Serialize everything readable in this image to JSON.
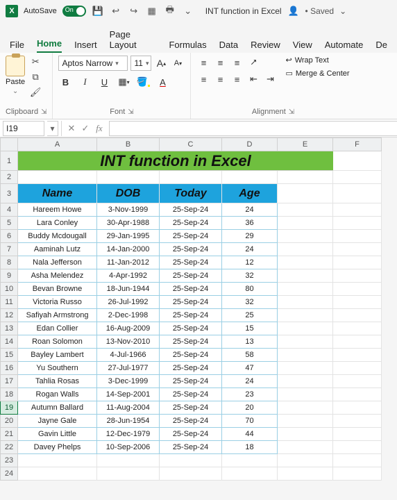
{
  "titlebar": {
    "autosave_label": "AutoSave",
    "autosave_on_text": "On",
    "doc_title": "INT function in Excel",
    "saved_status": "• Saved",
    "saved_caret": "⌄"
  },
  "ribbon_tabs": [
    "File",
    "Home",
    "Insert",
    "Page Layout",
    "Formulas",
    "Data",
    "Review",
    "View",
    "Automate",
    "De"
  ],
  "active_ribbon_tab": "Home",
  "clipboard": {
    "paste_label": "Paste",
    "group_label": "Clipboard"
  },
  "font": {
    "name": "Aptos Narrow",
    "size": "11",
    "group_label": "Font",
    "increase_label": "A",
    "decrease_label": "A",
    "bold": "B",
    "italic": "I",
    "underline": "U"
  },
  "alignment": {
    "group_label": "Alignment",
    "wrap_label": "Wrap Text",
    "merge_label": "Merge & Center"
  },
  "name_box": "I19",
  "formula_value": "",
  "columns": [
    "A",
    "B",
    "C",
    "D",
    "E",
    "F"
  ],
  "row_numbers": [
    "1",
    "2",
    "3",
    "4",
    "5",
    "6",
    "7",
    "8",
    "9",
    "10",
    "11",
    "12",
    "13",
    "14",
    "15",
    "16",
    "17",
    "18",
    "19",
    "20",
    "21",
    "22",
    "23",
    "24"
  ],
  "selected_row": "19",
  "sheet": {
    "title": "INT function in Excel",
    "headers": {
      "name": "Name",
      "dob": "DOB",
      "today": "Today",
      "age": "Age"
    },
    "rows": [
      {
        "name": "Hareem Howe",
        "dob": "3-Nov-1999",
        "today": "25-Sep-24",
        "age": "24"
      },
      {
        "name": "Lara Conley",
        "dob": "30-Apr-1988",
        "today": "25-Sep-24",
        "age": "36"
      },
      {
        "name": "Buddy Mcdougall",
        "dob": "29-Jan-1995",
        "today": "25-Sep-24",
        "age": "29"
      },
      {
        "name": "Aaminah Lutz",
        "dob": "14-Jan-2000",
        "today": "25-Sep-24",
        "age": "24"
      },
      {
        "name": "Nala Jefferson",
        "dob": "11-Jan-2012",
        "today": "25-Sep-24",
        "age": "12"
      },
      {
        "name": "Asha Melendez",
        "dob": "4-Apr-1992",
        "today": "25-Sep-24",
        "age": "32"
      },
      {
        "name": "Bevan Browne",
        "dob": "18-Jun-1944",
        "today": "25-Sep-24",
        "age": "80"
      },
      {
        "name": "Victoria Russo",
        "dob": "26-Jul-1992",
        "today": "25-Sep-24",
        "age": "32"
      },
      {
        "name": "Safiyah Armstrong",
        "dob": "2-Dec-1998",
        "today": "25-Sep-24",
        "age": "25"
      },
      {
        "name": "Edan Collier",
        "dob": "16-Aug-2009",
        "today": "25-Sep-24",
        "age": "15"
      },
      {
        "name": "Roan Solomon",
        "dob": "13-Nov-2010",
        "today": "25-Sep-24",
        "age": "13"
      },
      {
        "name": "Bayley Lambert",
        "dob": "4-Jul-1966",
        "today": "25-Sep-24",
        "age": "58"
      },
      {
        "name": "Yu Southern",
        "dob": "27-Jul-1977",
        "today": "25-Sep-24",
        "age": "47"
      },
      {
        "name": "Tahlia Rosas",
        "dob": "3-Dec-1999",
        "today": "25-Sep-24",
        "age": "24"
      },
      {
        "name": "Rogan Walls",
        "dob": "14-Sep-2001",
        "today": "25-Sep-24",
        "age": "23"
      },
      {
        "name": "Autumn Ballard",
        "dob": "11-Aug-2004",
        "today": "25-Sep-24",
        "age": "20"
      },
      {
        "name": "Jayne Gale",
        "dob": "28-Jun-1954",
        "today": "25-Sep-24",
        "age": "70"
      },
      {
        "name": "Gavin Little",
        "dob": "12-Dec-1979",
        "today": "25-Sep-24",
        "age": "44"
      },
      {
        "name": "Davey Phelps",
        "dob": "10-Sep-2006",
        "today": "25-Sep-24",
        "age": "18"
      }
    ]
  },
  "colors": {
    "title_bg": "#6fbf3f",
    "header_bg": "#1ea3dd",
    "grid_border": "#9acfe4",
    "excel_green": "#107C41"
  }
}
